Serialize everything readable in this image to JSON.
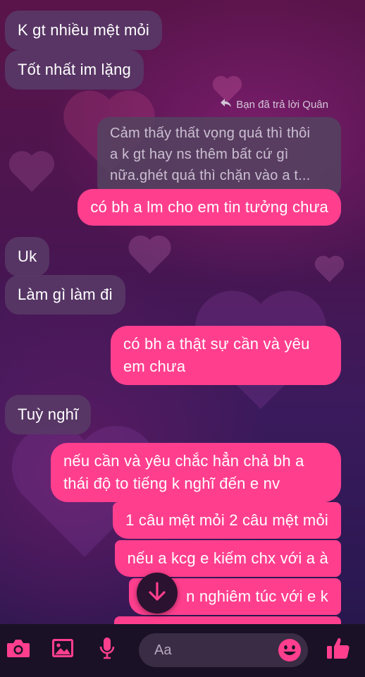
{
  "messages": [
    {
      "side": "in",
      "text": "K gt nhiều mệt mỏi"
    },
    {
      "side": "in",
      "text": "Tốt nhất im lặng"
    },
    {
      "side": "out",
      "text": "có bh a lm cho em tin tưởng chưa"
    },
    {
      "side": "in",
      "text": "Uk"
    },
    {
      "side": "in",
      "text": "Làm gì làm đi"
    },
    {
      "side": "out",
      "lines": [
        "có bh a thật sự cần và yêu",
        "em chưa"
      ]
    },
    {
      "side": "in",
      "text": "Tuỳ nghĩ"
    },
    {
      "side": "out",
      "lines": [
        "nếu cần và yêu chắc hẳn chả bh a",
        "thái độ to tiếng k nghĩ đến e nv"
      ]
    },
    {
      "side": "out",
      "text": "1 câu mệt mỏi 2 câu mệt mỏi"
    },
    {
      "side": "out",
      "text": "nếu a kcg e kiếm chx với a à"
    },
    {
      "side": "out",
      "text": "a        n nghiêm túc với e k"
    }
  ],
  "reply_header": "Bạn đã trả lời Quân",
  "quoted": [
    "Cảm thấy thất vọng quá thì thôi",
    "a k gt hay ns thêm bất cứ gì",
    "nữa.ghét quá thì chặn vào a t..."
  ],
  "composer": {
    "placeholder": "Aa"
  },
  "icons": {
    "camera": "camera-icon",
    "gallery": "gallery-icon",
    "mic": "microphone-icon",
    "emoji": "emoji-icon",
    "like": "thumbs-up-icon",
    "scroll": "arrow-down-icon",
    "reply": "reply-arrow-icon"
  },
  "colors": {
    "accent": "#ff3f8e",
    "incoming": "#583866",
    "toolbar": "#1a1126"
  }
}
